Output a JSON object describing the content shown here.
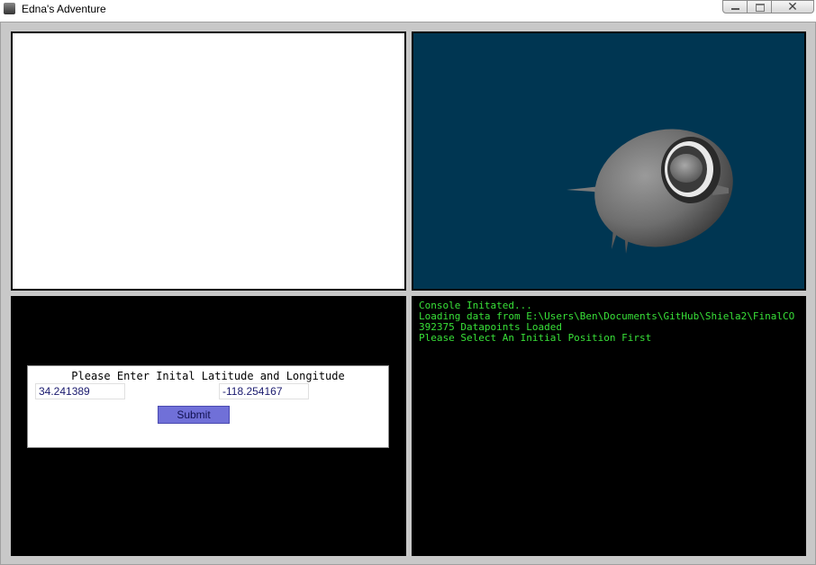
{
  "window": {
    "title": "Edna's Adventure",
    "close_glyph": "✕"
  },
  "input_form": {
    "prompt": "Please Enter Inital Latitude and Longitude",
    "latitude_value": "34.241389",
    "longitude_value": "-118.254167",
    "submit_label": "Submit"
  },
  "console": {
    "lines": [
      "Console Initated...",
      "Loading data from E:\\Users\\Ben\\Documents\\GitHub\\Shiela2\\FinalCO",
      "392375 Datapoints Loaded",
      "Please Select An Initial Position First"
    ]
  },
  "colors": {
    "viewport_bg": "#003652",
    "console_text": "#38e038",
    "submit_bg": "#7070d8"
  },
  "icons": [
    "app-icon",
    "minimize-icon",
    "maximize-icon",
    "close-icon"
  ]
}
